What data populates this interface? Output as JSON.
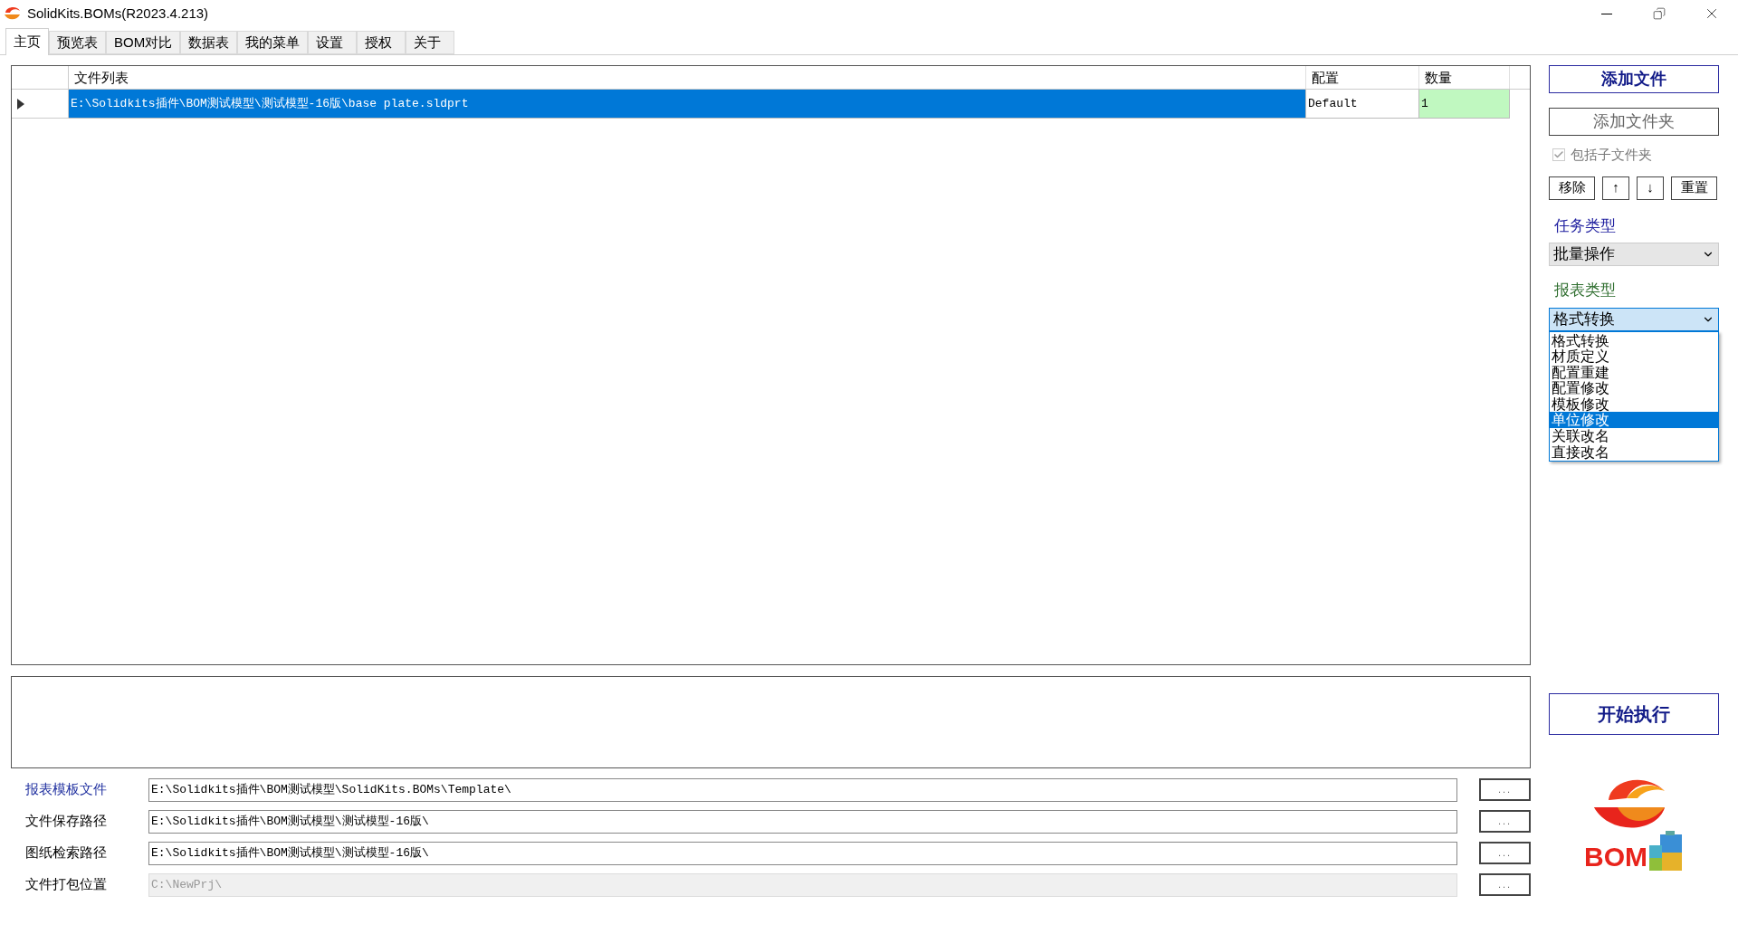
{
  "window": {
    "title": "SolidKits.BOMs(R2023.4.213)"
  },
  "tabs": [
    {
      "label": "主页",
      "selected": true
    },
    {
      "label": "预览表",
      "selected": false
    },
    {
      "label": "BOM对比",
      "selected": false
    },
    {
      "label": "数据表",
      "selected": false
    },
    {
      "label": "我的菜单",
      "selected": false
    },
    {
      "label": "设置",
      "selected": false
    },
    {
      "label": "授权",
      "selected": false
    },
    {
      "label": "关于",
      "selected": false
    }
  ],
  "file_table": {
    "columns": [
      "文件列表",
      "配置",
      "数量"
    ],
    "rows": [
      {
        "cells": [
          "E:\\Solidkits插件\\BOM测试模型\\测试模型-16版\\base plate.sldprt",
          "Default",
          "1"
        ],
        "selected": true
      }
    ]
  },
  "right_panel": {
    "add_file_button": "添加文件",
    "add_folder_button": "添加文件夹",
    "include_subfolders": {
      "label": "包括子文件夹",
      "checked": true,
      "disabled": true
    },
    "list_buttons": [
      "移除",
      "↑",
      "↓",
      "重置"
    ],
    "task_type": {
      "label": "任务类型",
      "value": "批量操作"
    },
    "report_type": {
      "label": "报表类型",
      "value": "格式转换",
      "expanded": true,
      "options": [
        {
          "label": "格式转换",
          "highlighted": false
        },
        {
          "label": "材质定义",
          "highlighted": false
        },
        {
          "label": "配置重建",
          "highlighted": false
        },
        {
          "label": "配置修改",
          "highlighted": false
        },
        {
          "label": "模板修改",
          "highlighted": false
        },
        {
          "label": "单位修改",
          "highlighted": true
        },
        {
          "label": "关联改名",
          "highlighted": false
        },
        {
          "label": "直接改名",
          "highlighted": false
        }
      ]
    },
    "start_button": "开始执行",
    "logo_text": "BOM"
  },
  "paths": [
    {
      "label": "报表模板文件",
      "value": "E:\\Solidkits插件\\BOM测试模型\\SolidKits.BOMs\\Template\\",
      "accent": true,
      "disabled": false,
      "browse": "..."
    },
    {
      "label": "文件保存路径",
      "value": "E:\\Solidkits插件\\BOM测试模型\\测试模型-16版\\",
      "accent": false,
      "disabled": false,
      "browse": "..."
    },
    {
      "label": "图纸检索路径",
      "value": "E:\\Solidkits插件\\BOM测试模型\\测试模型-16版\\",
      "accent": false,
      "disabled": false,
      "browse": "..."
    },
    {
      "label": "文件打包位置",
      "value": "C:\\NewPrj\\",
      "accent": false,
      "disabled": true,
      "browse": "..."
    }
  ]
}
